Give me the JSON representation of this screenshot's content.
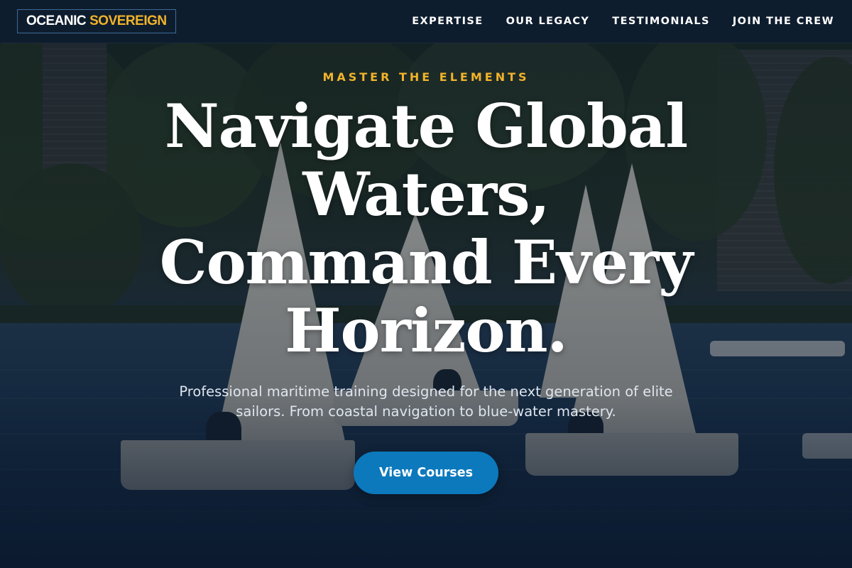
{
  "header": {
    "logo_primary": "OCEANIC",
    "logo_accent": "SOVEREIGN",
    "nav": [
      {
        "label": "EXPERTISE"
      },
      {
        "label": "OUR LEGACY"
      },
      {
        "label": "TESTIMONIALS"
      },
      {
        "label": "JOIN THE CREW"
      }
    ]
  },
  "hero": {
    "eyebrow": "MASTER THE ELEMENTS",
    "headline": "Navigate Global Waters, Command Every Horizon.",
    "subtext": "Professional maritime training designed for the next generation of elite sailors. From coastal navigation to blue-water mastery.",
    "cta_label": "View Courses"
  },
  "colors": {
    "header_bg": "#0e1d2e",
    "accent_gold": "#f2b32a",
    "cta_blue": "#0c79bd",
    "logo_border": "#3d6a96"
  },
  "icons": []
}
